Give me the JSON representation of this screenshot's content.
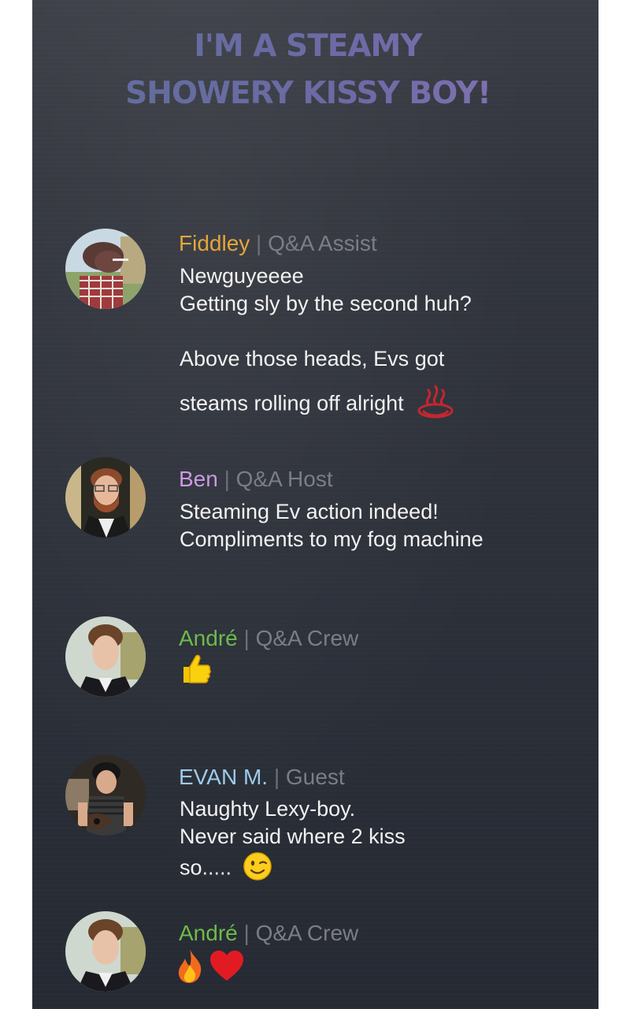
{
  "header": {
    "title_line1": "I'M A STEAMY",
    "title_line2": "SHOWERY KISSY BOY!"
  },
  "messages": [
    {
      "name": "Fiddley",
      "name_color": "#e5a53a",
      "separator": "|",
      "role": "Q&A Assist",
      "lines": [
        "Newguyeeee",
        "Getting sly by the second huh?",
        "Above those heads, Evs got",
        "steams rolling off alright"
      ],
      "emoji": "hot-springs-icon"
    },
    {
      "name": "Ben",
      "name_color": "#c99be0",
      "separator": "|",
      "role": "Q&A Host",
      "lines": [
        "Steaming Ev action indeed!",
        "Compliments to my fog machine"
      ]
    },
    {
      "name": "André",
      "name_color": "#6dbb4c",
      "separator": "|",
      "role": "Q&A Crew",
      "lines": [],
      "emoji": "thumbs-up-icon"
    },
    {
      "name": "EVAN M.",
      "name_color": "#9ccbe9",
      "separator": "|",
      "role": "Guest",
      "lines": [
        "Naughty Lexy-boy.",
        "Never said where 2 kiss",
        "so....."
      ],
      "emoji": "winking-face-icon"
    },
    {
      "name": "André",
      "name_color": "#6dbb4c",
      "separator": "|",
      "role": "Q&A Crew",
      "lines": [],
      "emoji": [
        "fire-icon",
        "red-heart-icon"
      ]
    }
  ]
}
